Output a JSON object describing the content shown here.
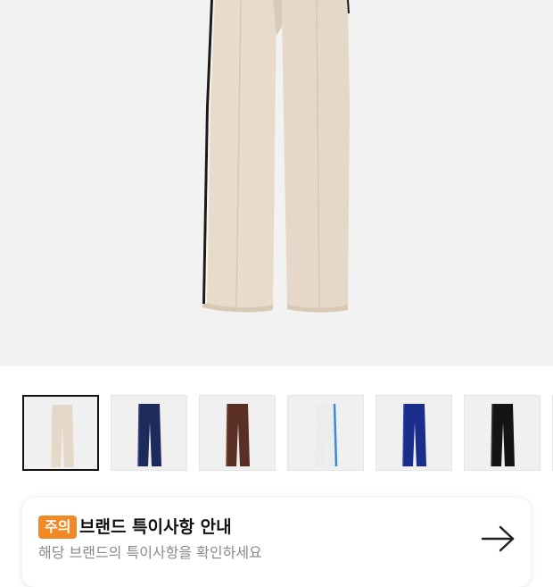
{
  "product": {
    "image": "cream-track-pants",
    "colors": {
      "cream": "#e8dbcb",
      "stripe": "#1a1a1a",
      "background": "#f2f2f2"
    }
  },
  "thumbnails": [
    {
      "variant": "cream",
      "color": "#e6d8c8",
      "stripe": "#f0e8de",
      "selected": true
    },
    {
      "variant": "navy",
      "color": "#1d2a5c",
      "stripe": "#3a4a7a",
      "selected": false
    },
    {
      "variant": "brown",
      "color": "#5a3026",
      "stripe": "#7a4638",
      "selected": false
    },
    {
      "variant": "white-blue",
      "color": "#ececec",
      "stripe": "#3a8ad6",
      "selected": false
    },
    {
      "variant": "royal-blue",
      "color": "#1b2d8a",
      "stripe": "#2e44b0",
      "selected": false
    },
    {
      "variant": "black",
      "color": "#141414",
      "stripe": "#3a3a3a",
      "selected": false
    }
  ],
  "notice": {
    "badge": "주의",
    "title": "브랜드 특이사항 안내",
    "subtitle": "해당 브랜드의 특이사항을 확인하세요",
    "arrow_icon": "arrow-right-icon",
    "badge_color": "#f08a24"
  }
}
